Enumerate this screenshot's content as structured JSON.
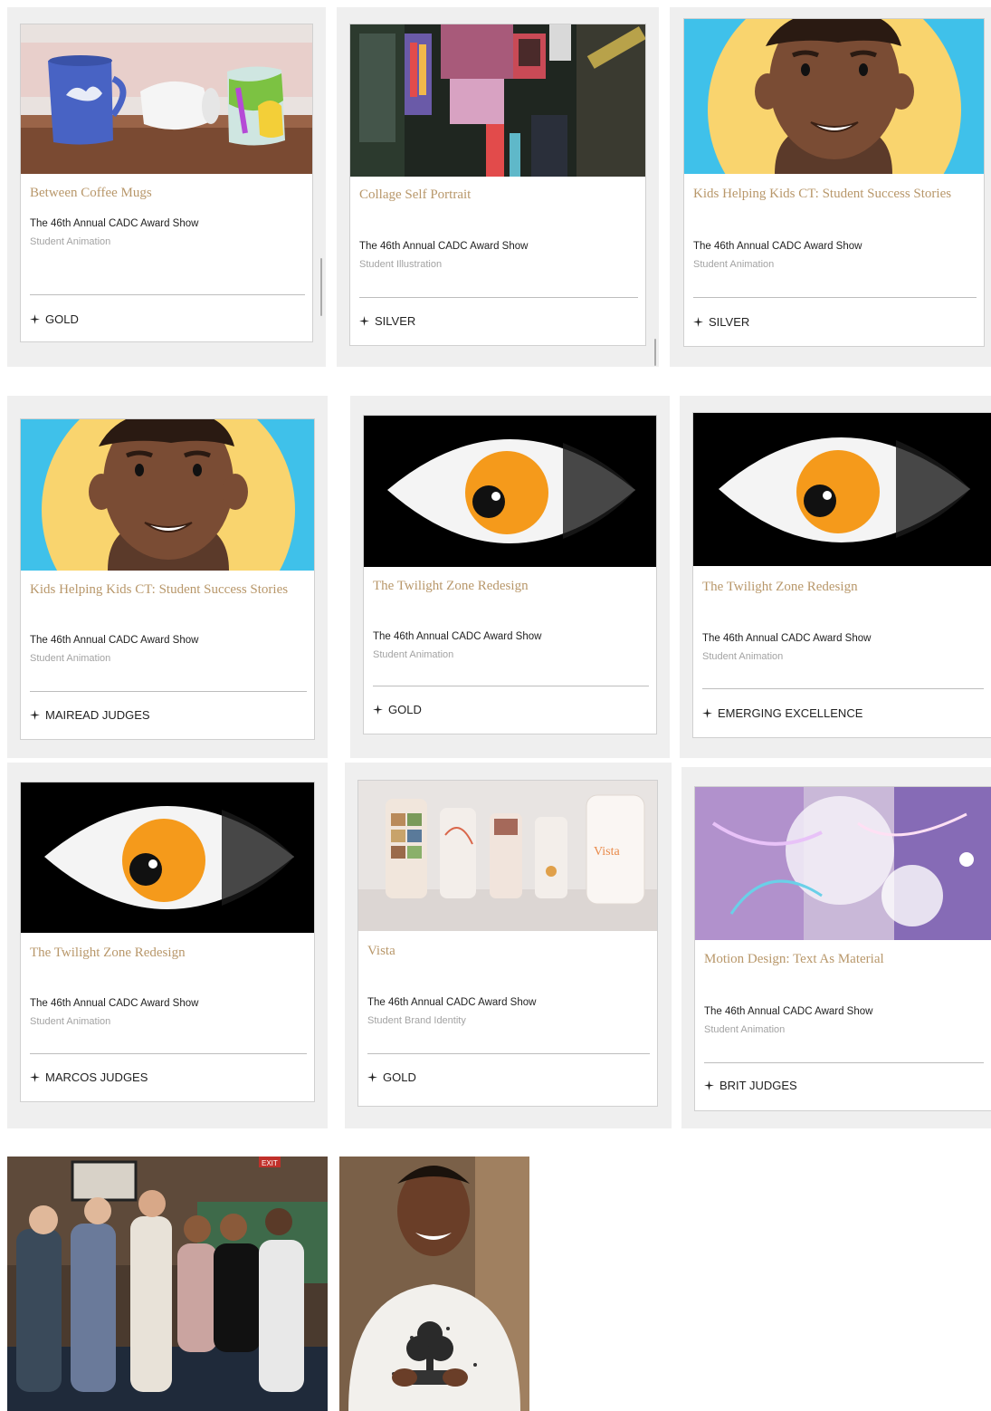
{
  "cards": [
    {
      "title": "Between Coffee Mugs",
      "show": "The 46th Annual CADC Award Show",
      "category": "Student Animation",
      "award": "GOLD",
      "thumb": "mugs"
    },
    {
      "title": "Collage Self Portrait",
      "show": "The 46th Annual CADC Award Show",
      "category": "Student Illustration",
      "award": "SILVER",
      "thumb": "collage"
    },
    {
      "title": "Kids Helping Kids CT: Student Success Stories",
      "show": "The 46th Annual CADC Award Show",
      "category": "Student Animation",
      "award": "SILVER",
      "thumb": "kid"
    },
    {
      "title": "Kids Helping Kids CT: Student Success Stories",
      "show": "The 46th Annual CADC Award Show",
      "category": "Student Animation",
      "award": "MAIREAD JUDGES",
      "thumb": "kid"
    },
    {
      "title": "The Twilight Zone Redesign",
      "show": "The 46th Annual CADC Award Show",
      "category": "Student Animation",
      "award": "GOLD",
      "thumb": "eye"
    },
    {
      "title": "The Twilight Zone Redesign",
      "show": "The 46th Annual CADC Award Show",
      "category": "Student Animation",
      "award": "EMERGING EXCELLENCE",
      "thumb": "eye"
    },
    {
      "title": "The Twilight Zone Redesign",
      "show": "The 46th Annual CADC Award Show",
      "category": "Student Animation",
      "award": "MARCOS JUDGES",
      "thumb": "eye"
    },
    {
      "title": "Vista",
      "show": "The 46th Annual CADC Award Show",
      "category": "Student Brand Identity",
      "award": "GOLD",
      "thumb": "vista",
      "thumb_text": "Vista"
    },
    {
      "title": "Motion Design: Text As Material",
      "show": "The 46th Annual CADC Award Show",
      "category": "Student Animation",
      "award": "BRIT JUDGES",
      "thumb": "motion"
    }
  ],
  "photos": [
    {
      "name": "group-photo",
      "exit_sign": "EXIT"
    },
    {
      "name": "single-photo"
    }
  ],
  "colors": {
    "title": "#b8976a",
    "panel": "#efefef",
    "eye_orange": "#f59a1b",
    "sky": "#3fc1ea",
    "sun": "#f9d46e"
  }
}
